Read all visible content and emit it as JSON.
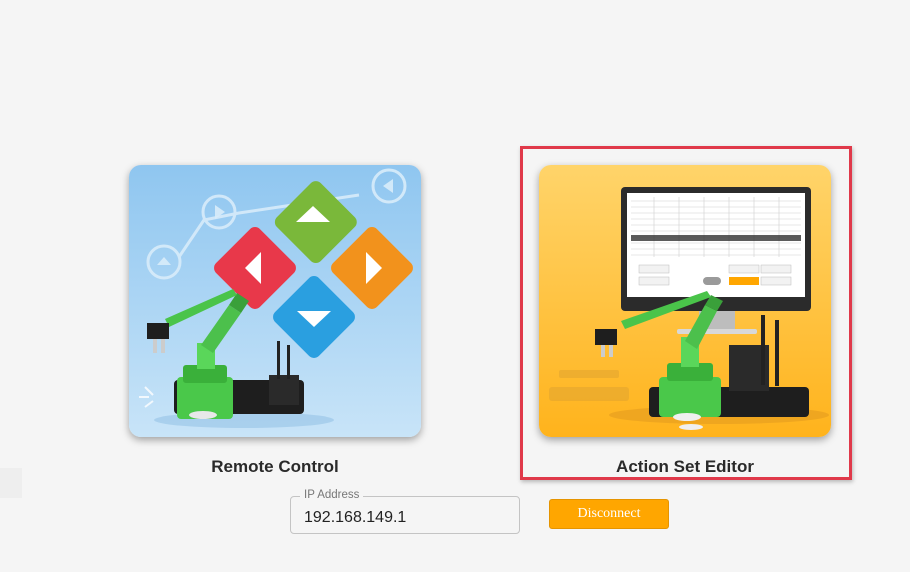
{
  "cards": {
    "remote_control": {
      "label": "Remote Control"
    },
    "action_set_editor": {
      "label": "Action Set Editor"
    }
  },
  "connection": {
    "ip_label": "IP Address",
    "ip_value": "192.168.149.1",
    "disconnect_label": "Disconnect"
  },
  "colors": {
    "background": "#f5f5f5",
    "highlight": "#e0394a",
    "disconnect_button": "#ffa600",
    "remote_card_bg": "#a8d4f2",
    "action_card_bg": "#ffc53a",
    "arrow_green": "#7ab83a",
    "arrow_red": "#e8384a",
    "arrow_orange": "#f2921c",
    "arrow_blue": "#2a9fe0"
  },
  "icons": [
    "arrow-up-icon",
    "arrow-left-icon",
    "arrow-right-icon",
    "arrow-down-icon",
    "robot-arm-icon",
    "monitor-icon"
  ]
}
